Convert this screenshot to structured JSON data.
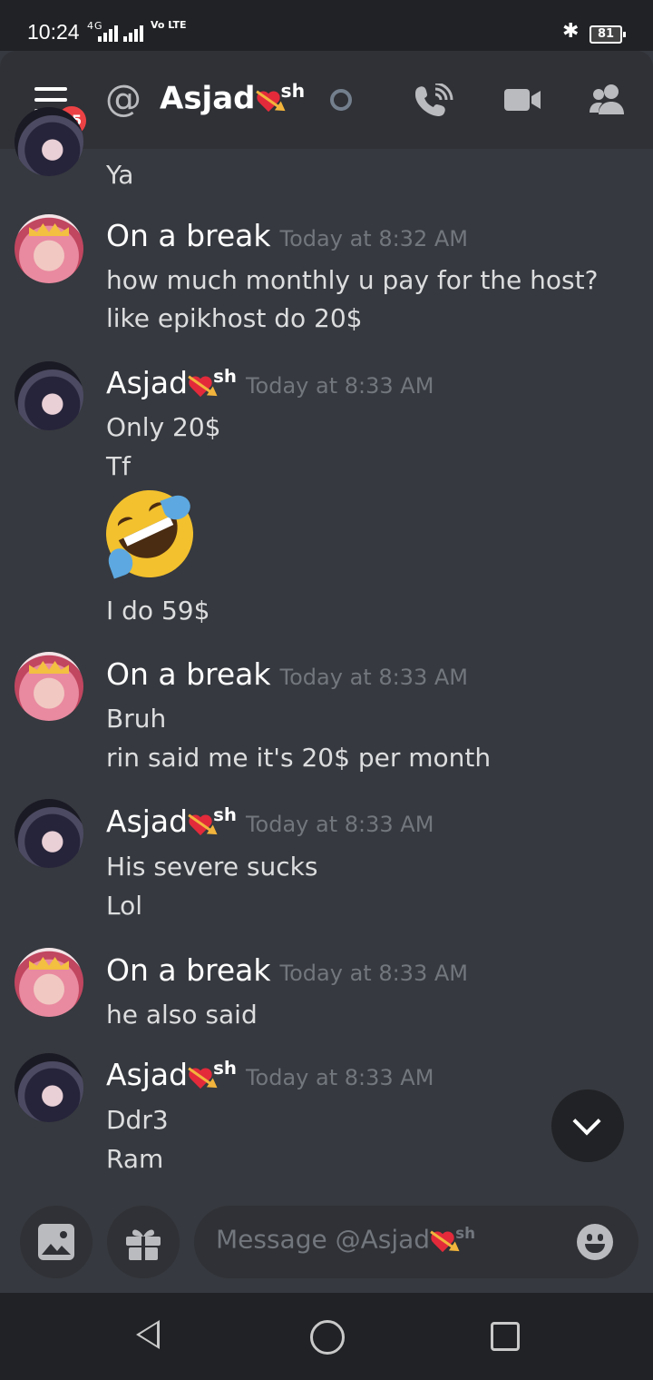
{
  "status_bar": {
    "time": "10:24",
    "network": "4G",
    "volte": "Vo LTE",
    "battery": "81"
  },
  "header": {
    "nav_badge": "25",
    "at_symbol": "@",
    "username": "Asjad",
    "username_suffix": "sh"
  },
  "messages": [
    {
      "id": "m0",
      "lines": [
        "Ya"
      ]
    },
    {
      "id": "m1",
      "author": "On a break",
      "timestamp": "Today at 8:32 AM",
      "lines": [
        "how much monthly u pay for the host?",
        "like epikhost do 20$"
      ]
    },
    {
      "id": "m2",
      "author": "Asjad",
      "author_suffix": "sh",
      "timestamp": "Today at 8:33 AM",
      "lines": [
        "Only 20$",
        "Tf",
        "I do 59$"
      ],
      "emoji": "rolling-on-the-floor-laughing"
    },
    {
      "id": "m3",
      "author": "On a break",
      "timestamp": "Today at 8:33 AM",
      "lines": [
        "Bruh",
        "rin said me it's 20$ per month"
      ]
    },
    {
      "id": "m4",
      "author": "Asjad",
      "author_suffix": "sh",
      "timestamp": "Today at 8:33 AM",
      "lines": [
        "His severe sucks",
        "Lol"
      ]
    },
    {
      "id": "m5",
      "author": "On a break",
      "timestamp": "Today at 8:33 AM",
      "lines": [
        "he also said"
      ]
    },
    {
      "id": "m6",
      "author": "Asjad",
      "author_suffix": "sh",
      "timestamp": "Today at 8:33 AM",
      "lines": [
        "Ddr3",
        "Ram"
      ]
    }
  ],
  "composer": {
    "placeholder": "Message @Asjad",
    "placeholder_suffix": "sh"
  },
  "colors": {
    "background": "#36393f",
    "header": "#2f3136",
    "badge": "#ed4245",
    "timestamp": "#72767d"
  }
}
